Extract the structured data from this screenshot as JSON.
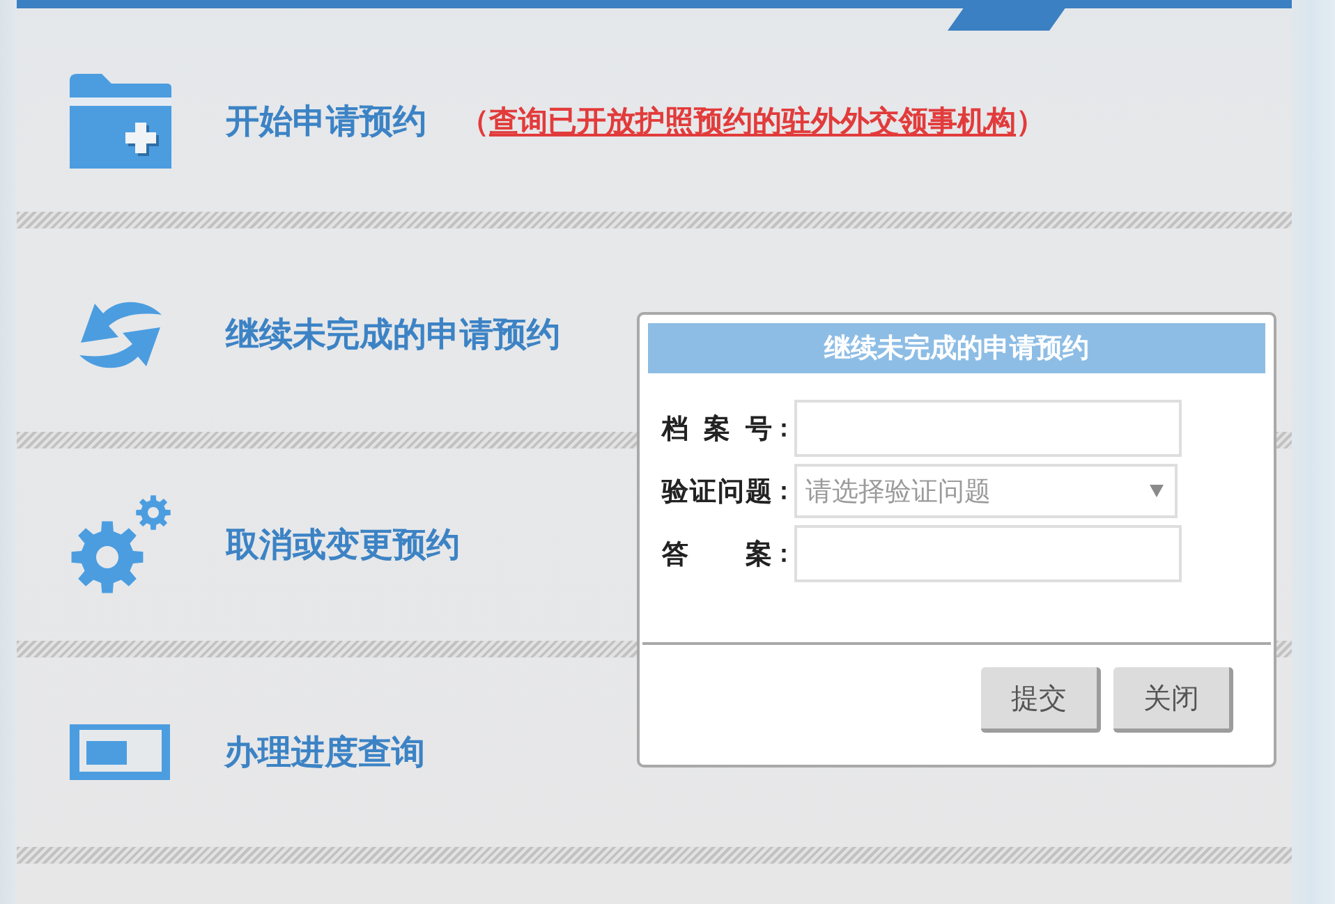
{
  "menu": [
    {
      "title": "开始申请预约",
      "note": {
        "open": "（",
        "link": "查询已开放护照预约的驻外外交领事机构",
        "close": "）"
      }
    },
    {
      "title": "继续未完成的申请预约"
    },
    {
      "title": "取消或变更预约"
    },
    {
      "title": "办理进度查询"
    }
  ],
  "dialog": {
    "title": "继续未完成的申请预约",
    "fields": [
      {
        "kind": "text",
        "label": "档 案 号",
        "colon": "："
      },
      {
        "kind": "select",
        "label": "验证问题",
        "colon": "：",
        "placeholder": "请选择验证问题"
      },
      {
        "kind": "text",
        "label": "答 案",
        "colon": "："
      }
    ],
    "buttons": [
      "提交",
      "关闭"
    ]
  }
}
